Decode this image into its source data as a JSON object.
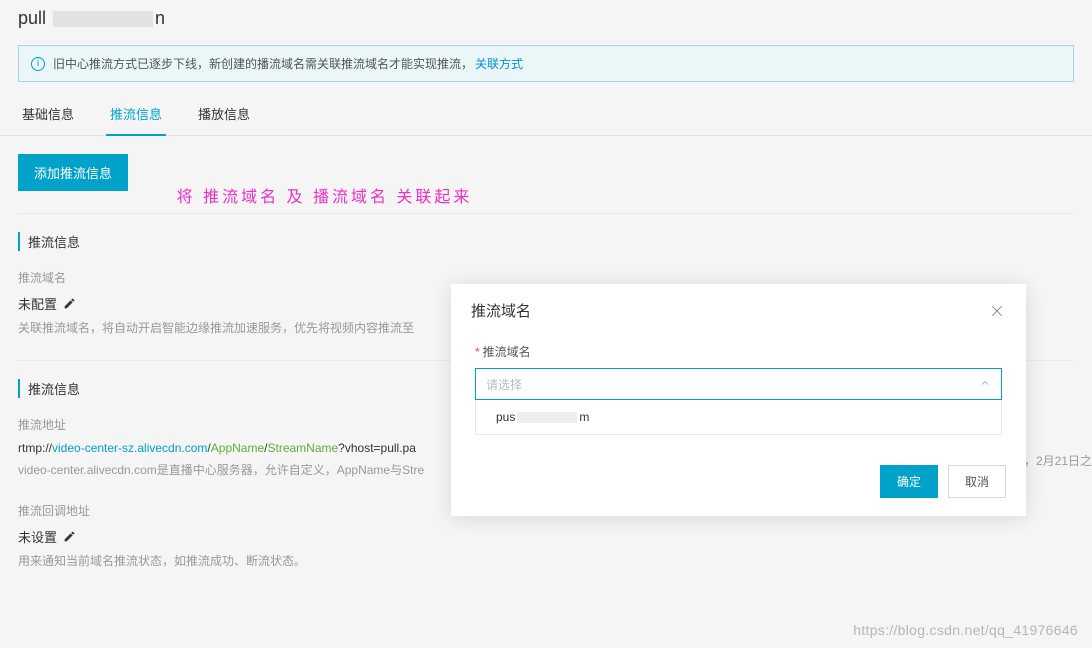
{
  "header": {
    "title_prefix": "pull",
    "title_suffix": "n"
  },
  "banner": {
    "text": "旧中心推流方式已逐步下线，新创建的播流域名需关联推流域名才能实现推流，",
    "link": "关联方式"
  },
  "tabs": [
    {
      "label": "基础信息",
      "active": false
    },
    {
      "label": "推流信息",
      "active": true
    },
    {
      "label": "播放信息",
      "active": false
    }
  ],
  "toolbar": {
    "add_button": "添加推流信息"
  },
  "annotation": "将  推流域名  及  播流域名  关联起来",
  "section1": {
    "title": "推流信息",
    "domain_label": "推流域名",
    "domain_value": "未配置",
    "domain_desc_prefix": "关联推流域名，将自动开启智能边缘推流加速服务，优先将视频内容推流至"
  },
  "section2": {
    "title": "推流信息",
    "addr_label": "推流地址",
    "rtmp": {
      "proto": "rtmp://",
      "host": "video-center-sz.alivecdn.com",
      "app": "AppName",
      "stream": "StreamName",
      "query": "?vhost=pull.pa"
    },
    "addr_desc": "video-center.alivecdn.com是直播中心服务器，允许自定义，AppName与Stre",
    "callback_label": "推流回调地址",
    "callback_value": "未设置",
    "callback_desc": "用来通知当前域名推流状态，如推流成功、断流状态。"
  },
  "truncated_right": "，2月21日之",
  "modal": {
    "title": "推流域名",
    "field_label": "推流域名",
    "placeholder": "请选择",
    "option_prefix": "pus",
    "option_suffix": "m",
    "confirm": "确定",
    "cancel": "取消"
  },
  "watermark": "https://blog.csdn.net/qq_41976646"
}
